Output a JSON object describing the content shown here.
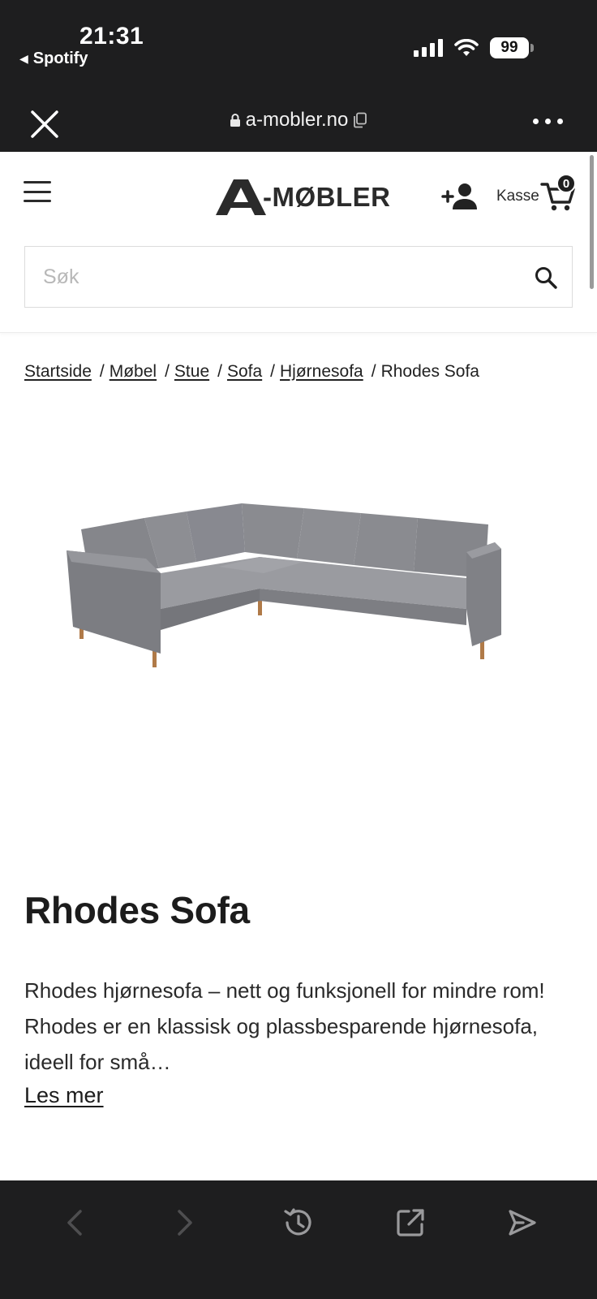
{
  "status_bar": {
    "time": "21:31",
    "back_app": "Spotify",
    "battery": "99"
  },
  "browser": {
    "url": "a-mobler.no"
  },
  "header": {
    "logo_text": "-MØBLER",
    "checkout_label": "Kasse",
    "cart_count": "0",
    "search_placeholder": "Søk"
  },
  "breadcrumb": {
    "items": [
      "Startside",
      "Møbel",
      "Stue",
      "Sofa",
      "Hjørnesofa"
    ],
    "current": "Rhodes Sofa"
  },
  "product": {
    "title": "Rhodes Sofa",
    "description": "Rhodes hjørnesofa – nett og funksjonell for mindre rom! Rhodes er en klassisk og plassbesparende hjørnesofa, ideell for små…",
    "read_more": "Les mer",
    "color": "#8d8e93"
  },
  "colors": {
    "chrome_dark": "#1e1e1f",
    "text_dark": "#1c1c1c"
  }
}
